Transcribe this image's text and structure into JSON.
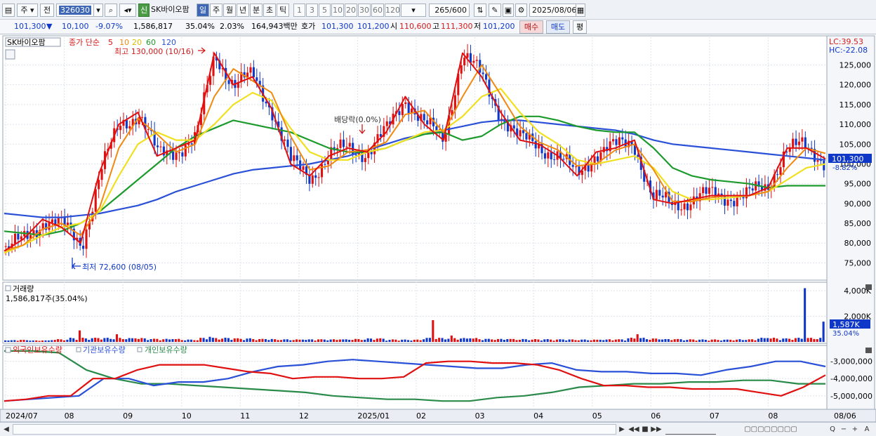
{
  "toolbar": {
    "type_a": "주",
    "type_b": "전",
    "code": "326030",
    "new_badge": "신",
    "stock_name": "SK바이오팜",
    "period_tabs": [
      "일",
      "주",
      "월",
      "년",
      "분",
      "초",
      "틱"
    ],
    "interval_buttons": [
      "1",
      "3",
      "5",
      "10",
      "20",
      "30",
      "60",
      "120"
    ],
    "count_display": "265",
    "count_total": "/600",
    "date": "2025/08/06"
  },
  "quote": {
    "price": "101,300",
    "direction": "▼",
    "change": "10,100",
    "change_pct": "-9.07%",
    "volume": "1,586,817",
    "turnover_pct": "35.04%",
    "other_pct": "2.03%",
    "amount": "164,943백만",
    "ask_label": "호가",
    "ask": "101,300",
    "bid": "101,200",
    "open_label": "시",
    "open": "110,600",
    "high_label": "고",
    "high": "111,300",
    "low_label": "저",
    "low": "101,200",
    "buy_button": "매수",
    "sell_button": "매도",
    "eval_button": "평"
  },
  "legend": {
    "stock": "SK바이오팜",
    "close_label": "종가 단순",
    "ma_labels": [
      "5",
      "10",
      "20",
      "60",
      "120"
    ]
  },
  "annotations": {
    "high": "최고 130,000 (10/16)",
    "low": "최저 72,600 (08/05)",
    "dividend": "배당락(0.0%)",
    "lc": "LC:39.53",
    "hc": "HC:-22.08",
    "current_price": "101,300",
    "current_pct": "-8.82%",
    "volume_title": "거래량",
    "volume_value": "1,586,817주(35.04%)",
    "volume_current": "1,587K",
    "volume_pct": "35.04%",
    "holding_legend": [
      "외국인보유수량",
      "기관보유수량",
      "개인보유수량"
    ],
    "last_date": "08/06"
  },
  "colors": {
    "ma5": "#e01010",
    "ma10": "#f08a10",
    "ma20": "#f0e020",
    "ma60": "#1c9a2c",
    "ma120": "#2a50d8",
    "up": "#e01010",
    "down": "#1038c8",
    "foreign": "#e01010",
    "institution": "#2a50d8",
    "individual": "#2a8a4a"
  },
  "chart_data": {
    "type": "line",
    "x": [
      "2024/07",
      "08",
      "09",
      "10",
      "11",
      "12",
      "2025/01",
      "02",
      "03",
      "04",
      "05",
      "06",
      "07",
      "08"
    ],
    "price_axis": [
      "125,000",
      "120,000",
      "115,000",
      "110,000",
      "105,000",
      "100,000",
      "95,000",
      "90,000",
      "85,000",
      "80,000",
      "75,000"
    ],
    "price_ylim": [
      71000,
      132000
    ],
    "price_close": [
      78000,
      81000,
      86000,
      84000,
      80000,
      98000,
      110000,
      113000,
      102000,
      104000,
      106000,
      128000,
      120000,
      122000,
      114000,
      100000,
      97000,
      102000,
      104000,
      103000,
      108000,
      117000,
      110000,
      106000,
      128000,
      122000,
      113000,
      106000,
      105000,
      102000,
      97000,
      103000,
      104000,
      106000,
      91000,
      90000,
      91000,
      92000,
      92000,
      92000,
      94000,
      104000,
      104000,
      101300
    ],
    "ma20": [
      77500,
      79500,
      82000,
      84000,
      85000,
      88000,
      97000,
      105000,
      108000,
      106000,
      106000,
      110000,
      115000,
      118000,
      116000,
      109000,
      103000,
      101000,
      101000,
      103000,
      104000,
      106000,
      108000,
      108500,
      112000,
      117000,
      119000,
      113000,
      108000,
      105000,
      101000,
      100000,
      101000,
      102000,
      99000,
      93000,
      91000,
      91000,
      91500,
      92000,
      93000,
      96000,
      99000,
      100000
    ],
    "ma60": [
      83000,
      82500,
      82000,
      83000,
      85000,
      88000,
      92000,
      96000,
      100000,
      104000,
      107000,
      109000,
      111000,
      110000,
      109000,
      108000,
      106000,
      104000,
      103000,
      103000,
      104000,
      106000,
      107500,
      108000,
      106000,
      107000,
      110000,
      112000,
      112000,
      111000,
      109500,
      108500,
      108000,
      108000,
      104000,
      99000,
      97000,
      96000,
      95500,
      95000,
      94000,
      94500,
      94500,
      94500
    ],
    "ma120": [
      87500,
      87000,
      86500,
      86500,
      87000,
      87500,
      88500,
      89500,
      91000,
      93000,
      94500,
      96000,
      97500,
      98500,
      99000,
      99500,
      100000,
      101000,
      102000,
      103500,
      105000,
      106500,
      107500,
      108500,
      109500,
      110500,
      111000,
      111000,
      110500,
      110000,
      109500,
      109000,
      108500,
      107500,
      106000,
      105000,
      104500,
      104000,
      103500,
      103000,
      102500,
      102000,
      101500,
      101000
    ],
    "volume_axis": [
      "4,000K",
      "2,000K"
    ],
    "volume_max": 4500,
    "volume_k": [
      120,
      160,
      110,
      200,
      900,
      300,
      600,
      280,
      250,
      220,
      180,
      400,
      300,
      260,
      220,
      200,
      180,
      210,
      190,
      220,
      260,
      180,
      170,
      1700,
      500,
      280,
      240,
      220,
      210,
      200,
      190,
      180,
      170,
      210,
      600,
      260,
      210,
      190,
      180,
      170,
      200,
      300,
      280,
      4200,
      1587
    ],
    "holding_axis": [
      "-3,000,000",
      "-4,000,000",
      "-5,000,000"
    ],
    "holding_ylim": [
      -5700000,
      -2200000
    ],
    "foreign": [
      -5300000,
      -5200000,
      -5000000,
      -5000000,
      -4000000,
      -4000000,
      -3500000,
      -3200000,
      -3200000,
      -3200000,
      -3400000,
      -3600000,
      -3700000,
      -4000000,
      -3900000,
      -3900000,
      -4000000,
      -4000000,
      -3900000,
      -3100000,
      -3000000,
      -3000000,
      -3100000,
      -3100000,
      -3200000,
      -3500000,
      -4000000,
      -4400000,
      -4400000,
      -4500000,
      -4500000,
      -4600000,
      -4600000,
      -4600000,
      -4800000,
      -5000000,
      -4500000,
      -3800000
    ],
    "institution": [
      -5300000,
      -5200000,
      -5100000,
      -5000000,
      -4000000,
      -4000000,
      -4400000,
      -4200000,
      -4200000,
      -4000000,
      -3600000,
      -3300000,
      -3200000,
      -3000000,
      -2900000,
      -3000000,
      -3100000,
      -3200000,
      -3300000,
      -3400000,
      -3400000,
      -3200000,
      -3100000,
      -3500000,
      -3600000,
      -3600000,
      -3700000,
      -3700000,
      -3800000,
      -3500000,
      -3300000,
      -3000000,
      -3000000,
      -3300000
    ],
    "individual": [
      -2400000,
      -2400000,
      -2500000,
      -3500000,
      -4000000,
      -4300000,
      -4300000,
      -4400000,
      -4500000,
      -4600000,
      -4700000,
      -4800000,
      -5000000,
      -5100000,
      -5200000,
      -5200000,
      -5300000,
      -5300000,
      -5100000,
      -5000000,
      -4800000,
      -4500000,
      -4400000,
      -4300000,
      -4300000,
      -4200000,
      -4200000,
      -4100000,
      -4100000,
      -4300000,
      -4300000
    ]
  },
  "status": {
    "buttons": [
      "◀",
      "▶",
      "◀◀",
      "■",
      "▶▶",
      "Q",
      "−",
      "+",
      "A"
    ]
  }
}
